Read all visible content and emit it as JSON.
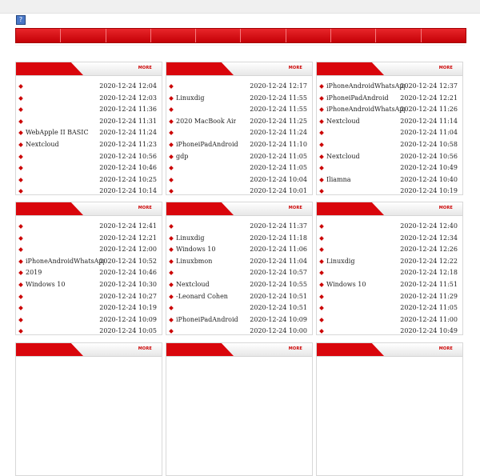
{
  "header": {
    "help_icon": "?"
  },
  "nav": {
    "item_count": 10
  },
  "panels": [
    {
      "more_label": "MORE",
      "rows": [
        {
          "title": "",
          "date": "2020-12-24 12:04"
        },
        {
          "title": "",
          "date": "2020-12-24 12:03"
        },
        {
          "title": "",
          "date": "2020-12-24 11:36"
        },
        {
          "title": "",
          "date": "2020-12-24 11:31"
        },
        {
          "title": "WebApple II BASIC",
          "date": "2020-12-24 11:24"
        },
        {
          "title": "Nextcloud",
          "date": "2020-12-24 11:23"
        },
        {
          "title": "",
          "date": "2020-12-24 10:56"
        },
        {
          "title": "",
          "date": "2020-12-24 10:46"
        },
        {
          "title": "",
          "date": "2020-12-24 10:25"
        },
        {
          "title": "",
          "date": "2020-12-24 10:14"
        }
      ]
    },
    {
      "more_label": "MORE",
      "rows": [
        {
          "title": "",
          "date": "2020-12-24 12:17"
        },
        {
          "title": "Linuxdig",
          "date": "2020-12-24 11:55"
        },
        {
          "title": "",
          "date": "2020-12-24 11:55"
        },
        {
          "title": "2020 MacBook Air",
          "date": "2020-12-24 11:25"
        },
        {
          "title": "",
          "date": "2020-12-24 11:24"
        },
        {
          "title": "iPhoneiPadAndroid",
          "date": "2020-12-24 11:10"
        },
        {
          "title": "gdp",
          "date": "2020-12-24 11:05"
        },
        {
          "title": "",
          "date": "2020-12-24 11:05"
        },
        {
          "title": "",
          "date": "2020-12-24 10:04"
        },
        {
          "title": "",
          "date": "2020-12-24 10:01"
        }
      ]
    },
    {
      "more_label": "MORE",
      "rows": [
        {
          "title": "iPhoneAndroidWhatsApp",
          "date": "2020-12-24 12:37"
        },
        {
          "title": "iPhoneiPadAndroid",
          "date": "2020-12-24 12:21"
        },
        {
          "title": "iPhoneAndroidWhatsApp",
          "date": "2020-12-24 11:26"
        },
        {
          "title": "Nextcloud",
          "date": "2020-12-24 11:14"
        },
        {
          "title": "",
          "date": "2020-12-24 11:04"
        },
        {
          "title": "",
          "date": "2020-12-24 10:58"
        },
        {
          "title": "Nextcloud",
          "date": "2020-12-24 10:56"
        },
        {
          "title": "",
          "date": "2020-12-24 10:49"
        },
        {
          "title": "Iliamna",
          "date": "2020-12-24 10:40"
        },
        {
          "title": "",
          "date": "2020-12-24 10:19"
        }
      ]
    },
    {
      "more_label": "MORE",
      "rows": [
        {
          "title": "",
          "date": "2020-12-24 12:41"
        },
        {
          "title": "",
          "date": "2020-12-24 12:21"
        },
        {
          "title": "",
          "date": "2020-12-24 12:00"
        },
        {
          "title": "iPhoneAndroidWhatsApp",
          "date": "2020-12-24 10:52"
        },
        {
          "title": "2019",
          "date": "2020-12-24 10:46"
        },
        {
          "title": "Windows 10",
          "date": "2020-12-24 10:30"
        },
        {
          "title": "",
          "date": "2020-12-24 10:27"
        },
        {
          "title": "",
          "date": "2020-12-24 10:19"
        },
        {
          "title": "",
          "date": "2020-12-24 10:09"
        },
        {
          "title": "",
          "date": "2020-12-24 10:05"
        }
      ]
    },
    {
      "more_label": "MORE",
      "rows": [
        {
          "title": "",
          "date": "2020-12-24 11:37"
        },
        {
          "title": "Linuxdig",
          "date": "2020-12-24 11:18"
        },
        {
          "title": "Windows 10",
          "date": "2020-12-24 11:06"
        },
        {
          "title": "Linuxbmon",
          "date": "2020-12-24 11:04"
        },
        {
          "title": "",
          "date": "2020-12-24 10:57"
        },
        {
          "title": "Nextcloud",
          "date": "2020-12-24 10:55"
        },
        {
          "title": "-Leonard Cohen",
          "date": "2020-12-24 10:51"
        },
        {
          "title": "",
          "date": "2020-12-24 10:51"
        },
        {
          "title": "iPhoneiPadAndroid",
          "date": "2020-12-24 10:09"
        },
        {
          "title": "",
          "date": "2020-12-24 10:00"
        }
      ]
    },
    {
      "more_label": "MORE",
      "rows": [
        {
          "title": "",
          "date": "2020-12-24 12:40"
        },
        {
          "title": "",
          "date": "2020-12-24 12:34"
        },
        {
          "title": "",
          "date": "2020-12-24 12:26"
        },
        {
          "title": "Linuxdig",
          "date": "2020-12-24 12:22"
        },
        {
          "title": "",
          "date": "2020-12-24 12:18"
        },
        {
          "title": "Windows 10",
          "date": "2020-12-24 11:51"
        },
        {
          "title": "",
          "date": "2020-12-24 11:29"
        },
        {
          "title": "",
          "date": "2020-12-24 11:05"
        },
        {
          "title": "",
          "date": "2020-12-24 11:00"
        },
        {
          "title": "",
          "date": "2020-12-24 10:49"
        }
      ]
    },
    {
      "more_label": "MORE",
      "rows": []
    },
    {
      "more_label": "MORE",
      "rows": []
    },
    {
      "more_label": "MORE",
      "rows": []
    }
  ]
}
